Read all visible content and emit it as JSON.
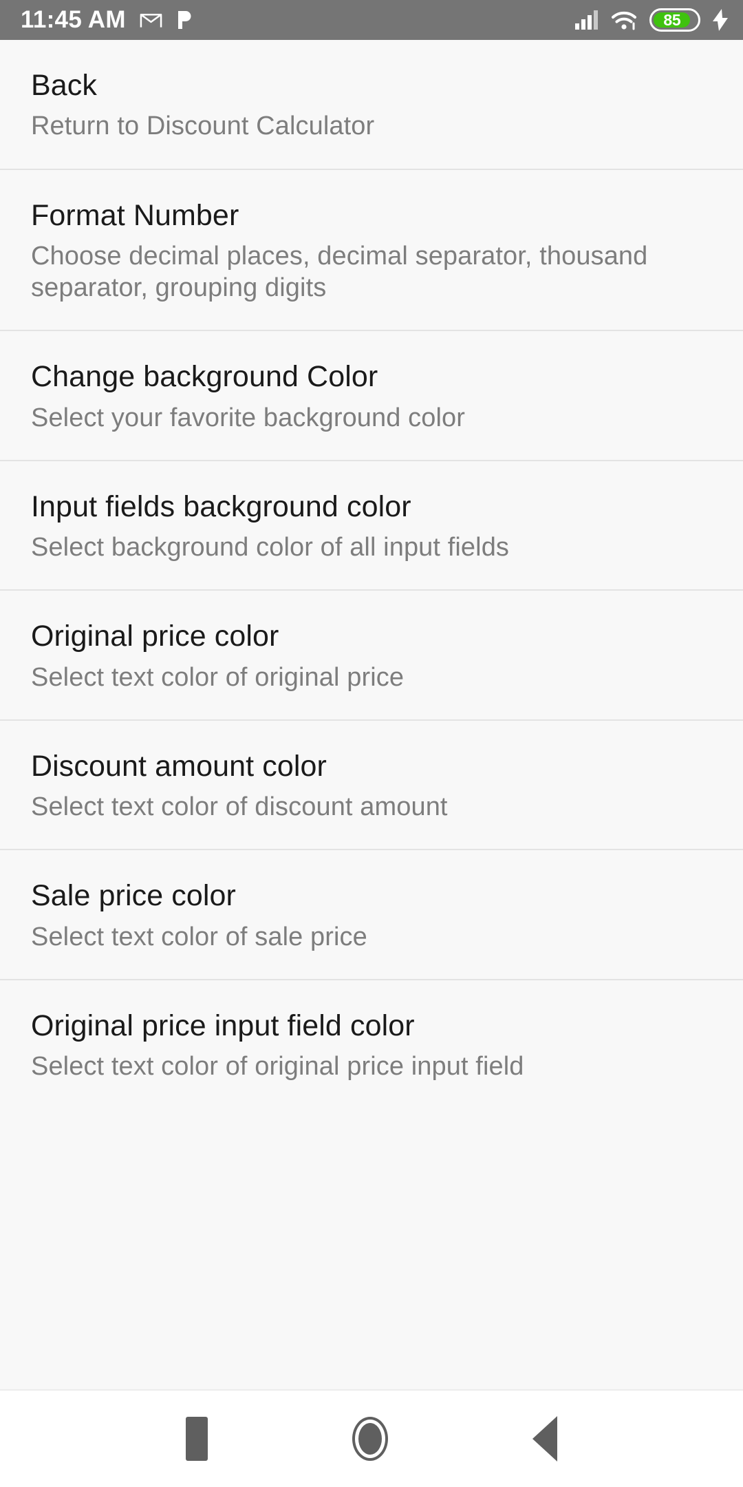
{
  "status_bar": {
    "time": "11:45 AM",
    "battery_percent": "85",
    "battery_level": 85,
    "colors": {
      "background": "#757575",
      "battery_fill": "#3fc20f",
      "text": "#ffffff"
    },
    "left_icons": [
      "gmail-icon",
      "pandora-icon"
    ],
    "right_icons": [
      "cellular-signal-icon",
      "wifi-icon",
      "battery-icon",
      "charging-bolt-icon"
    ]
  },
  "screen": {
    "theme": {
      "background": "#f8f8f8",
      "title_color": "#1a1a1a",
      "summary_color": "#7d7d7d",
      "divider_color": "#e3e3e3"
    }
  },
  "preferences": [
    {
      "title": "Back",
      "summary": "Return to Discount Calculator"
    },
    {
      "title": "Format Number",
      "summary": "Choose decimal places, decimal separator, thousand separator, grouping digits"
    },
    {
      "title": "Change background Color",
      "summary": "Select your favorite background color"
    },
    {
      "title": "Input fields background color",
      "summary": "Select background color of all input fields"
    },
    {
      "title": "Original price color",
      "summary": "Select text color of original price"
    },
    {
      "title": "Discount amount color",
      "summary": "Select text color of discount amount"
    },
    {
      "title": "Sale price color",
      "summary": "Select text color of sale price"
    },
    {
      "title": "Original price input field color",
      "summary": "Select text color of original price input field"
    }
  ],
  "nav_bar": {
    "recents_label": "Recents",
    "home_label": "Home",
    "back_label": "Back",
    "icon_color": "#5f5f5f"
  }
}
